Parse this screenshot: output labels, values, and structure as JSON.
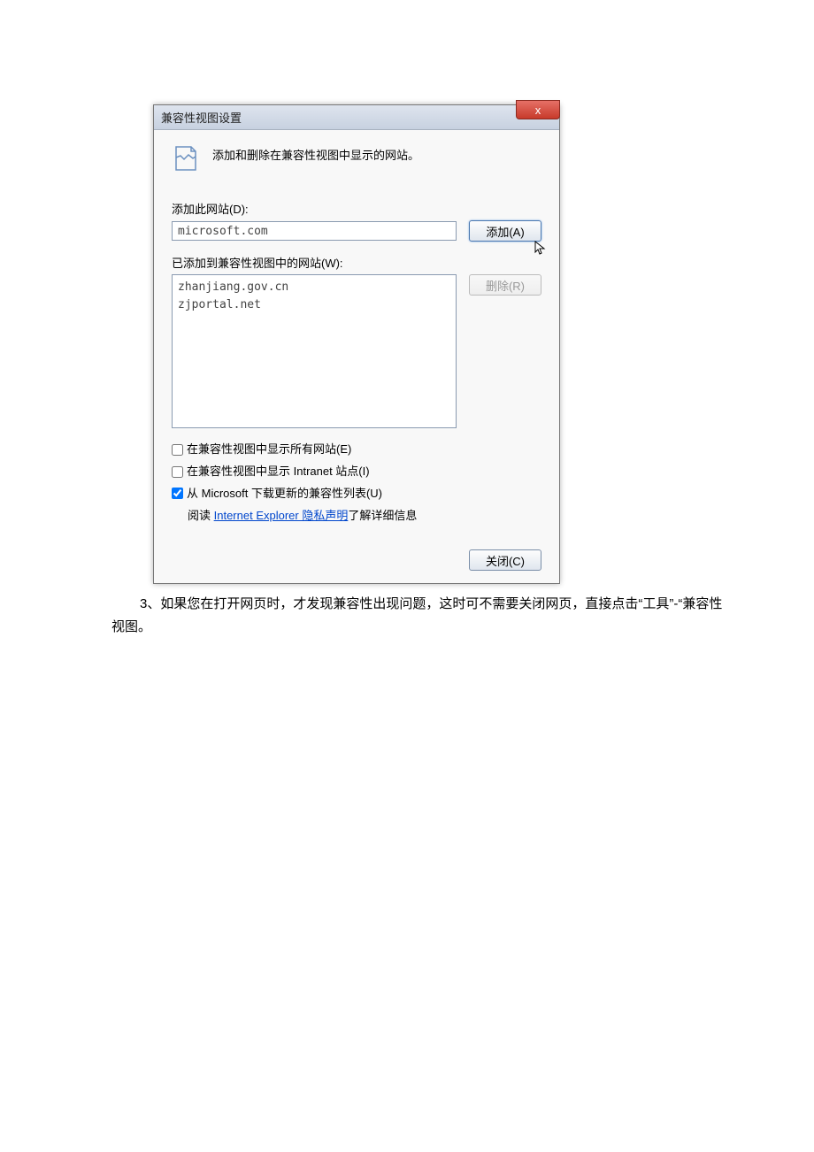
{
  "dialog": {
    "title": "兼容性视图设置",
    "close_symbol": "x",
    "header_text": "添加和删除在兼容性视图中显示的网站。",
    "add_label": "添加此网站(D):",
    "input_value": "microsoft.com",
    "add_button": "添加(A)",
    "added_label": "已添加到兼容性视图中的网站(W):",
    "sites": [
      "zhanjiang.gov.cn",
      "zjportal.net"
    ],
    "remove_button": "删除(R)",
    "checkbox1": "在兼容性视图中显示所有网站(E)",
    "checkbox2": "在兼容性视图中显示 Intranet 站点(I)",
    "checkbox3": "从 Microsoft 下载更新的兼容性列表(U)",
    "privacy_prefix": "阅读 ",
    "privacy_link": "Internet Explorer 隐私声明",
    "privacy_suffix": "了解详细信息",
    "close_button": "关闭(C)"
  },
  "document": {
    "paragraph": "3、如果您在打开网页时，才发现兼容性出现问题，这时可不需要关闭网页，直接点击“工具”-“兼容性视图。"
  }
}
